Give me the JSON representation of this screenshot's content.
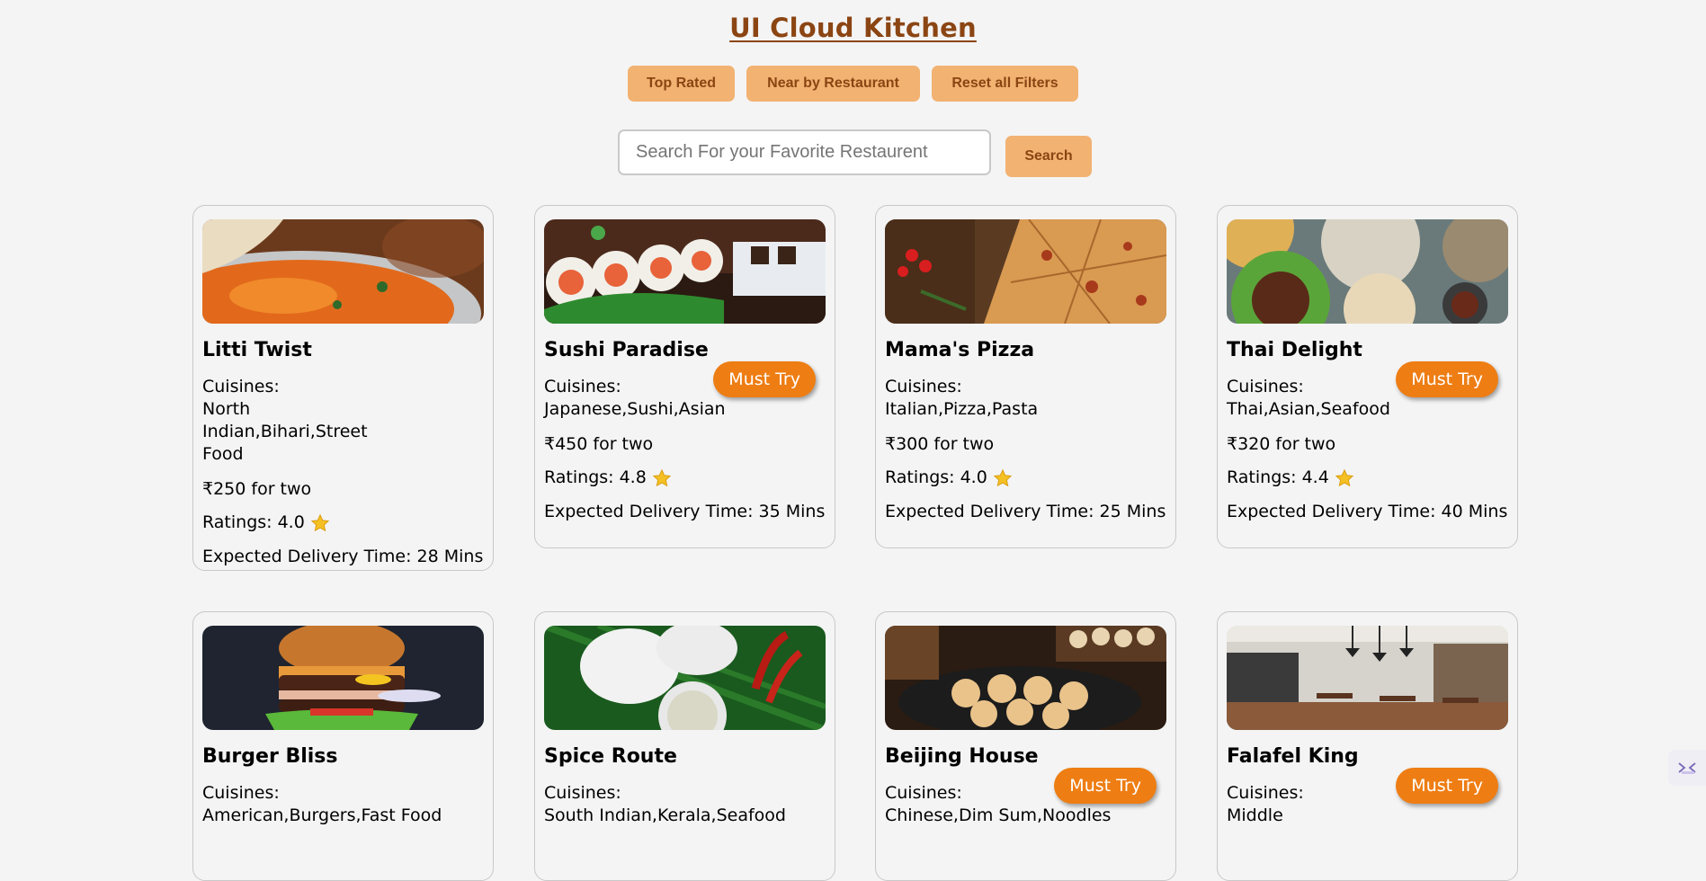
{
  "header": {
    "title": "UI Cloud Kitchen"
  },
  "filters": [
    {
      "label": "Top Rated"
    },
    {
      "label": "Near by Restaurant"
    },
    {
      "label": "Reset all Filters"
    }
  ],
  "search": {
    "placeholder": "Search For your Favorite Restaurent",
    "button_label": "Search"
  },
  "labels": {
    "cuisines": "Cuisines:",
    "must_try": "Must Try",
    "star_icon": "star-icon"
  },
  "restaurants": [
    {
      "name": "Litti Twist",
      "cuisines": "North Indian,Bihari,Street Food",
      "price": "₹250 for two",
      "rating": "Ratings: 4.0",
      "delivery": "Expected Delivery Time: 28 Mins",
      "must_try": false
    },
    {
      "name": "Sushi Paradise",
      "cuisines": "Japanese,Sushi,Asian",
      "price": "₹450 for two",
      "rating": "Ratings: 4.8",
      "delivery": "Expected Delivery Time: 35 Mins",
      "must_try": true
    },
    {
      "name": "Mama's Pizza",
      "cuisines": "Italian,Pizza,Pasta",
      "price": "₹300 for two",
      "rating": "Ratings: 4.0",
      "delivery": "Expected Delivery Time: 25 Mins",
      "must_try": false
    },
    {
      "name": "Thai Delight",
      "cuisines": "Thai,Asian,Seafood",
      "price": "₹320 for two",
      "rating": "Ratings: 4.4",
      "delivery": "Expected Delivery Time: 40 Mins",
      "must_try": true
    },
    {
      "name": "Burger Bliss",
      "cuisines": "American,Burgers,Fast Food",
      "must_try": false
    },
    {
      "name": "Spice Route",
      "cuisines": "South Indian,Kerala,Seafood",
      "must_try": false
    },
    {
      "name": "Beijing House",
      "cuisines": "Chinese,Dim Sum,Noodles",
      "must_try": true
    },
    {
      "name": "Falafel King",
      "cuisines": "Middle",
      "must_try": true
    }
  ],
  "colors": {
    "accent": "#f2b271",
    "title": "#8b4513",
    "must_try": "#ee7d13"
  }
}
